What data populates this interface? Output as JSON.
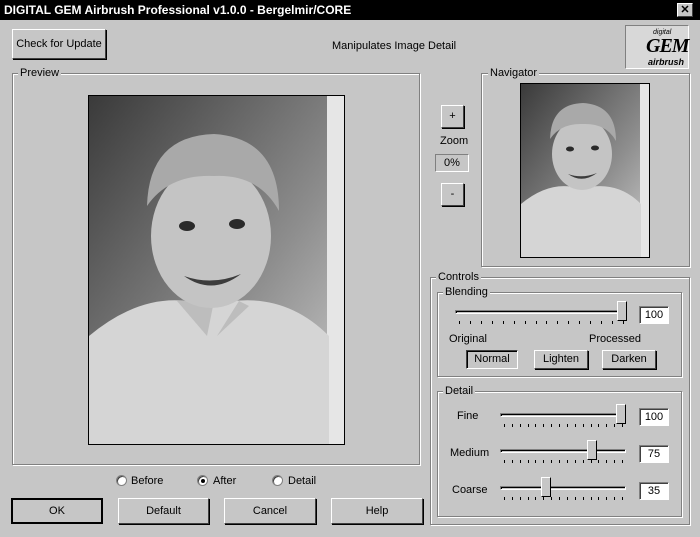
{
  "window": {
    "title": "DIGITAL GEM Airbrush Professional v1.0.0 - Bergelmir/CORE",
    "close_glyph": "✕"
  },
  "header": {
    "check_update_label": "Check for Update",
    "description": "Manipulates Image Detail",
    "logo": {
      "top": "digital",
      "main": "GEM",
      "sub": "airbrush"
    }
  },
  "preview": {
    "label": "Preview",
    "options": [
      {
        "label": "Before",
        "checked": false
      },
      {
        "label": "After",
        "checked": true
      },
      {
        "label": "Detail",
        "checked": false
      }
    ]
  },
  "zoom": {
    "plus": "+",
    "label": "Zoom",
    "value": "0%",
    "minus": "-"
  },
  "navigator": {
    "label": "Navigator"
  },
  "controls": {
    "label": "Controls",
    "blending": {
      "label": "Blending",
      "value": "100",
      "level": 1.0,
      "left_label": "Original",
      "right_label": "Processed",
      "buttons": [
        {
          "label": "Normal",
          "pressed": true
        },
        {
          "label": "Lighten",
          "pressed": false
        },
        {
          "label": "Darken",
          "pressed": false
        }
      ]
    },
    "detail": {
      "label": "Detail",
      "fine": {
        "label": "Fine",
        "value": "100",
        "level": 1.0
      },
      "medium": {
        "label": "Medium",
        "value": "75",
        "level": 0.75
      },
      "coarse": {
        "label": "Coarse",
        "value": "35",
        "level": 0.35
      }
    }
  },
  "footer": {
    "ok": "OK",
    "default": "Default",
    "cancel": "Cancel",
    "help": "Help"
  },
  "icons": {
    "close": "close-icon",
    "logo": "gem-logo"
  }
}
